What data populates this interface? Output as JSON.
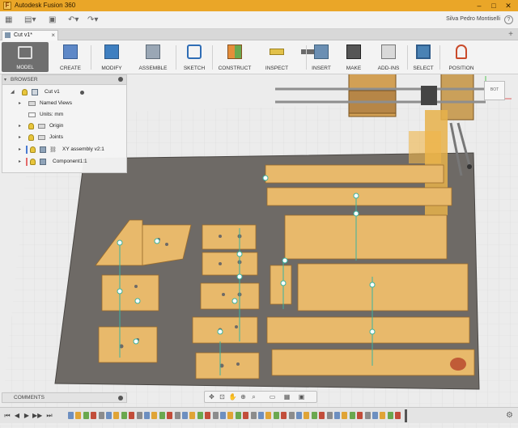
{
  "window": {
    "title": "Autodesk Fusion 360"
  },
  "qat": {
    "user": "Silva Pedro Montiselli",
    "help": "?"
  },
  "document_tab": {
    "label": "Cut v1*"
  },
  "ribbon": {
    "mode": "MODEL",
    "tools": [
      "CREATE",
      "MODIFY",
      "ASSEMBLE",
      "SKETCH",
      "CONSTRUCT",
      "INSPECT",
      "INSERT",
      "MAKE",
      "ADD-INS",
      "SELECT",
      "POSITION"
    ]
  },
  "browser": {
    "header": "BROWSER",
    "nodes": [
      "Cut v1",
      "Named Views",
      "Units: mm",
      "Origin",
      "Joints",
      "XY assembly v2:1",
      "Component1:1"
    ]
  },
  "viewcube": {
    "label": "BOT"
  },
  "comments": {
    "label": "COMMENTS"
  },
  "colors": {
    "titlebar": "#eaa628",
    "select_active": "#4a82b4",
    "plate": "#6e6a66",
    "wood": "#e8b96b",
    "joint": "#3ab3a0"
  }
}
